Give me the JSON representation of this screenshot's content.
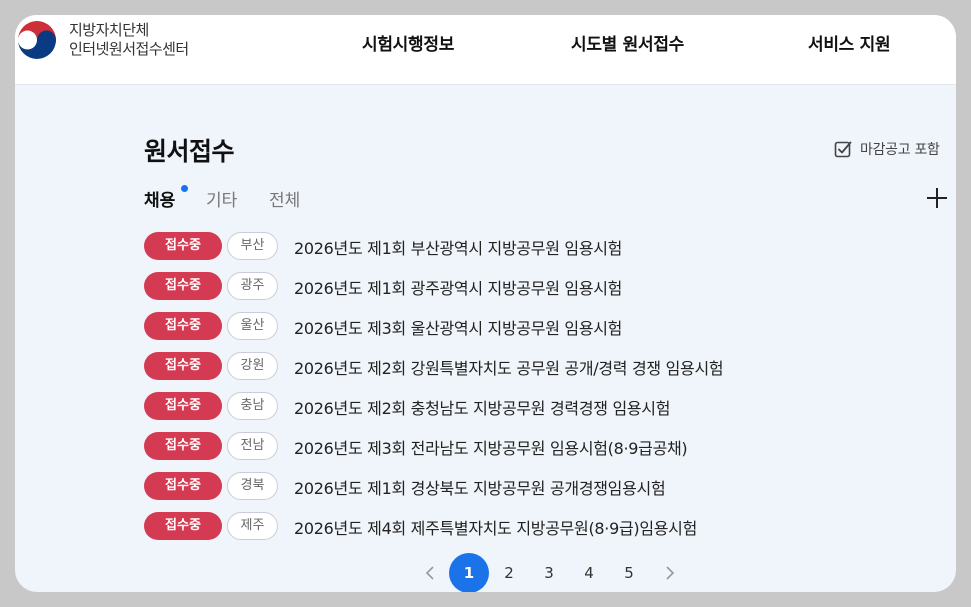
{
  "header": {
    "logo_line1": "지방자치단체",
    "logo_line2": "인터넷원서접수센터",
    "nav": [
      "시험시행정보",
      "시도별 원서접수",
      "서비스 지원"
    ]
  },
  "section": {
    "title": "원서접수",
    "include_closed_label": "마감공고 포함"
  },
  "tabs": [
    "채용",
    "기타",
    "전체"
  ],
  "list": [
    {
      "status": "접수중",
      "region": "부산",
      "title": "2026년도 제1회 부산광역시 지방공무원 임용시험"
    },
    {
      "status": "접수중",
      "region": "광주",
      "title": "2026년도 제1회 광주광역시 지방공무원 임용시험"
    },
    {
      "status": "접수중",
      "region": "울산",
      "title": "2026년도 제3회 울산광역시 지방공무원 임용시험"
    },
    {
      "status": "접수중",
      "region": "강원",
      "title": "2026년도 제2회 강원특별자치도 공무원 공개/경력 경쟁 임용시험"
    },
    {
      "status": "접수중",
      "region": "충남",
      "title": "2026년도 제2회 충청남도 지방공무원 경력경쟁 임용시험"
    },
    {
      "status": "접수중",
      "region": "전남",
      "title": "2026년도 제3회 전라남도 지방공무원 임용시험(8·9급공채)"
    },
    {
      "status": "접수중",
      "region": "경북",
      "title": "2026년도 제1회 경상북도 지방공무원 공개경쟁임용시험"
    },
    {
      "status": "접수중",
      "region": "제주",
      "title": "2026년도 제4회 제주특별자치도 지방공무원(8·9급)임용시험"
    }
  ],
  "pagination": {
    "pages": [
      "1",
      "2",
      "3",
      "4",
      "5"
    ],
    "current": "1"
  },
  "colors": {
    "accent": "#1a73e8",
    "status_open": "#d43a51",
    "background": "#f0f5fb"
  }
}
